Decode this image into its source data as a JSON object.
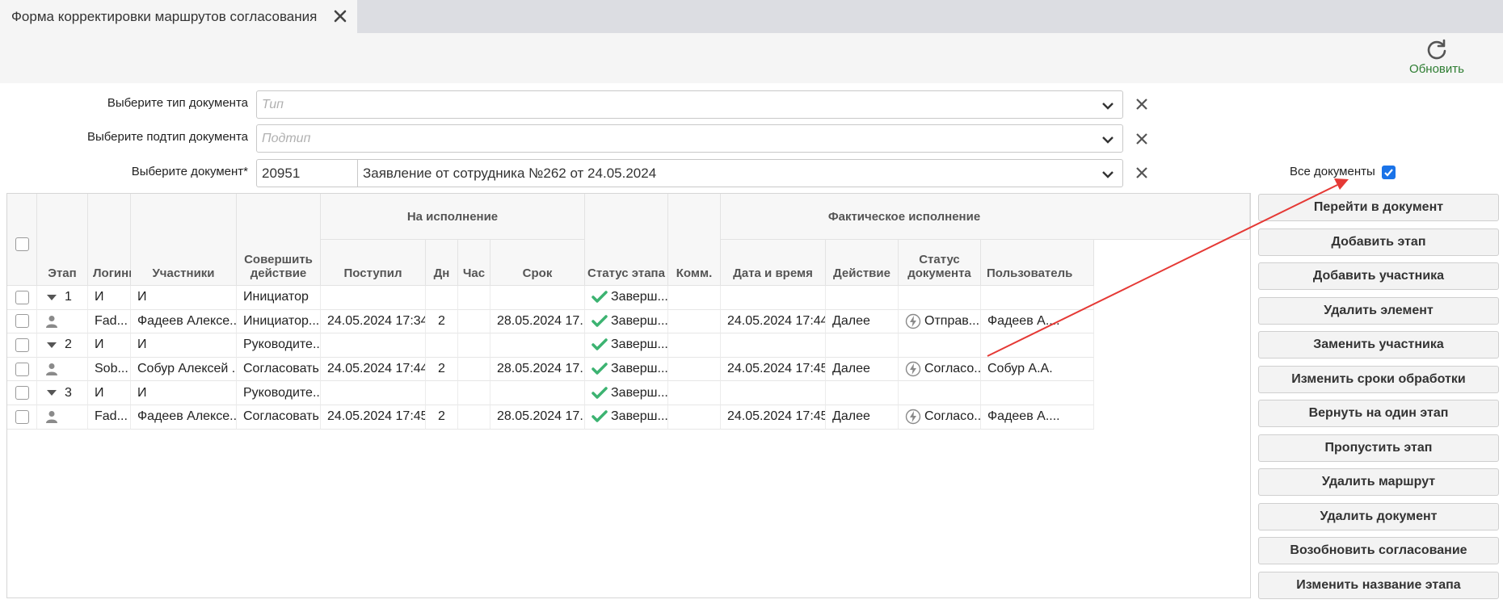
{
  "tab": {
    "title": "Форма корректировки маршрутов согласования",
    "close_icon": "close-icon"
  },
  "toolbar": {
    "refresh_label": "Обновить",
    "refresh_icon": "refresh-icon",
    "refresh_color": "#2e7d32"
  },
  "filters": {
    "doc_type": {
      "label": "Выберите тип документа",
      "placeholder": "Тип"
    },
    "doc_subtype": {
      "label": "Выберите подтип документа",
      "placeholder": "Подтип"
    },
    "document": {
      "label": "Выберите документ*",
      "id_value": "20951",
      "name_value": "Заявление от сотрудника №262 от 24.05.2024"
    },
    "all_docs": {
      "label": "Все документы",
      "checked": true
    }
  },
  "grid": {
    "group_headers": {
      "execution": "На исполнение",
      "actual": "Фактическое исполнение"
    },
    "columns": {
      "stage": "Этап",
      "login": "Логины",
      "participants": "Участники",
      "action_line1": "Совершить",
      "action_line2": "действие",
      "received": "Поступил",
      "days": "Дн",
      "hours": "Час",
      "deadline": "Срок",
      "stage_status": "Статус этапа",
      "comment": "Комм.",
      "datetime": "Дата и время",
      "act": "Действие",
      "doc_status_line1": "Статус",
      "doc_status_line2": "документа",
      "user": "Пользователь"
    },
    "rows": [
      {
        "type": "stage",
        "stage": "1",
        "login": "И",
        "participant": "И",
        "action": "Инициатор",
        "received": "",
        "days": "",
        "hours": "",
        "deadline": "",
        "stage_status": "Заверш...",
        "comment": "",
        "datetime": "",
        "act": "",
        "doc_status": "",
        "user": ""
      },
      {
        "type": "user",
        "stage": "",
        "login": "Fad...",
        "participant": "Фадеев Алексе...",
        "action": "Инициатор...",
        "received": "24.05.2024 17:34",
        "days": "2",
        "hours": "",
        "deadline": "28.05.2024 17...",
        "stage_status": "Заверш...",
        "comment": "",
        "datetime": "24.05.2024 17:44",
        "act": "Далее",
        "doc_status": "Отправ...",
        "user": "Фадеев А...."
      },
      {
        "type": "stage",
        "stage": "2",
        "login": "И",
        "participant": "И",
        "action": "Руководите...",
        "received": "",
        "days": "",
        "hours": "",
        "deadline": "",
        "stage_status": "Заверш...",
        "comment": "",
        "datetime": "",
        "act": "",
        "doc_status": "",
        "user": ""
      },
      {
        "type": "user",
        "stage": "",
        "login": "Sob...",
        "participant": "Собур Алексей ...",
        "action": "Согласовать",
        "received": "24.05.2024 17:44",
        "days": "2",
        "hours": "",
        "deadline": "28.05.2024 17...",
        "stage_status": "Заверш...",
        "comment": "",
        "datetime": "24.05.2024 17:45",
        "act": "Далее",
        "doc_status": "Согласо...",
        "user": "Собур А.А."
      },
      {
        "type": "stage",
        "stage": "3",
        "login": "И",
        "participant": "И",
        "action": "Руководите...",
        "received": "",
        "days": "",
        "hours": "",
        "deadline": "",
        "stage_status": "Заверш...",
        "comment": "",
        "datetime": "",
        "act": "",
        "doc_status": "",
        "user": ""
      },
      {
        "type": "user",
        "stage": "",
        "login": "Fad...",
        "participant": "Фадеев Алексе...",
        "action": "Согласовать",
        "received": "24.05.2024 17:45",
        "days": "2",
        "hours": "",
        "deadline": "28.05.2024 17...",
        "stage_status": "Заверш...",
        "comment": "",
        "datetime": "24.05.2024 17:45",
        "act": "Далее",
        "doc_status": "Согласо...",
        "user": "Фадеев А...."
      }
    ]
  },
  "side_buttons": [
    "Перейти в документ",
    "Добавить этап",
    "Добавить участника",
    "Удалить элемент",
    "Заменить участника",
    "Изменить сроки обработки",
    "Вернуть на один этап",
    "Пропустить этап",
    "Удалить маршрут",
    "Удалить документ",
    "Возобновить согласование",
    "Изменить название этапа"
  ],
  "colors": {
    "status_ok": "#3cb371",
    "annotation_arrow": "#e53935",
    "checkbox_accent": "#1a73e8"
  }
}
